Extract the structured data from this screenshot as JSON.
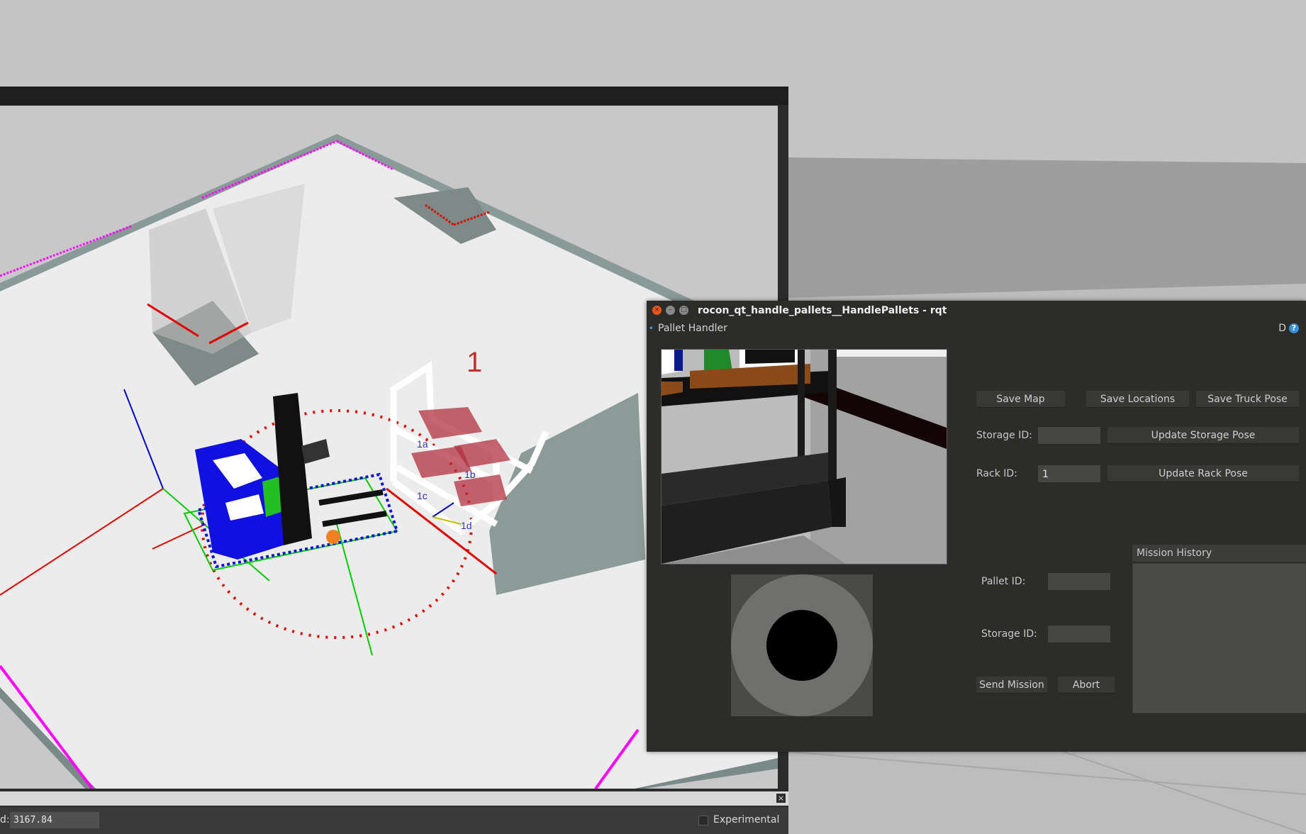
{
  "viewport_window": {
    "rviz_label": "1",
    "slot_labels": [
      "1a",
      "1b",
      "1c",
      "1d"
    ],
    "status_label": "d:",
    "status_value": "3167.84",
    "experimental_label": "Experimental",
    "close_glyph": "×"
  },
  "rqt_window": {
    "title": "rocon_qt_handle_pallets__HandlePallets - rqt",
    "plugin_title": "Pallet Handler",
    "plugin_d": "D",
    "help_glyph": "?",
    "save_map_label": "Save Map",
    "save_locations_label": "Save Locations",
    "save_truck_pose_label": "Save Truck Pose",
    "storage_id_label": "Storage ID:",
    "storage_id_value": "",
    "update_storage_pose_label": "Update Storage Pose",
    "rack_id_label": "Rack ID:",
    "rack_id_value": "1",
    "update_rack_pose_label": "Update Rack Pose",
    "pallet_id_label": "Pallet ID:",
    "pallet_id_value": "",
    "mission_storage_id_label": "Storage ID:",
    "mission_storage_id_value": "",
    "send_mission_label": "Send Mission",
    "abort_label": "Abort",
    "mission_history_label": "Mission History"
  },
  "colors": {
    "accent_close": "#e95420",
    "help_blue": "#3b8ed8",
    "boundary_magenta": "#ff00ff",
    "marker_red": "#e00000",
    "forklift_blue": "#1010e0"
  }
}
